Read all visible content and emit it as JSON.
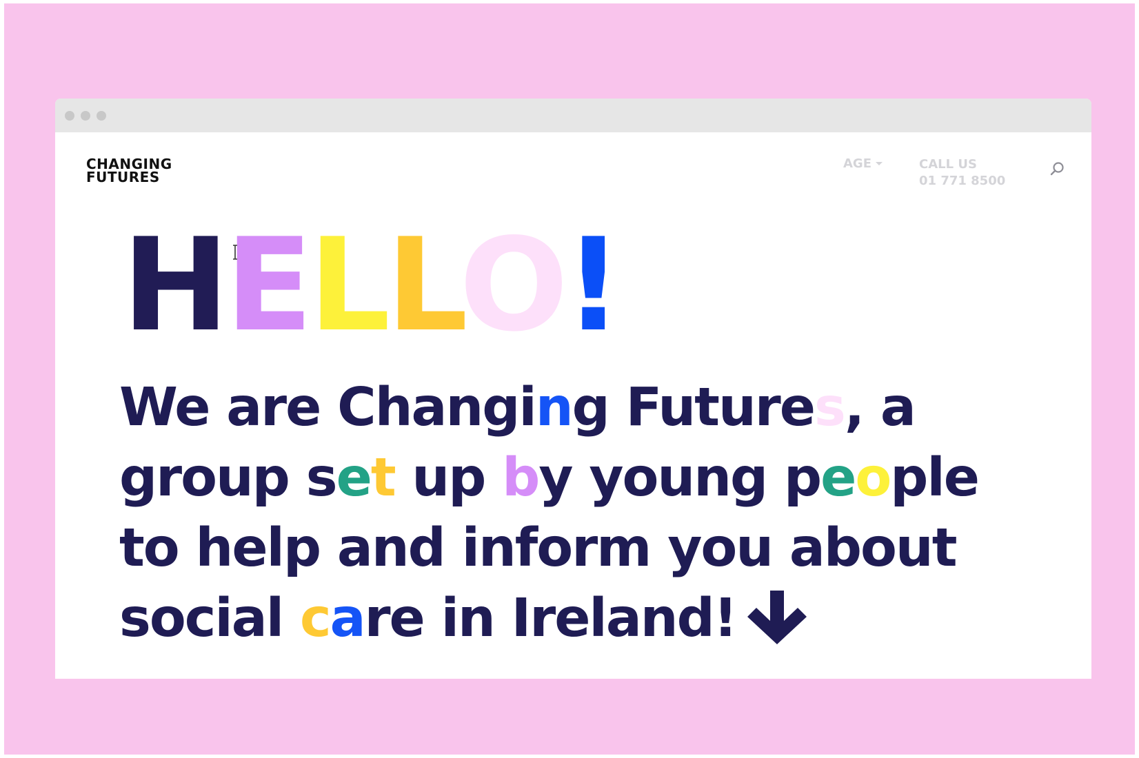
{
  "header": {
    "logo": [
      "CHANGING",
      "FUTURES"
    ],
    "nav": {
      "age_label": "AGE",
      "call_title": "CALL US",
      "call_number": "01 771 8500"
    }
  },
  "hero": {
    "hello": [
      {
        "ch": "H",
        "color": "#211c55"
      },
      {
        "ch": "E",
        "color": "#d58df8"
      },
      {
        "ch": "L",
        "color": "#fdf13a"
      },
      {
        "ch": "L",
        "color": "#fec934"
      },
      {
        "ch": "O",
        "color": "#fde0fa"
      },
      {
        "ch": "!",
        "color": "#0b4ff7"
      }
    ],
    "intro_lines": [
      [
        {
          "t": "We are Changi"
        },
        {
          "t": "n",
          "color": "#1554f6"
        },
        {
          "t": "g Future"
        },
        {
          "t": "s",
          "color": "#fde0fa"
        },
        {
          "t": ", a"
        }
      ],
      [
        {
          "t": "group s"
        },
        {
          "t": "e",
          "color": "#23a286"
        },
        {
          "t": "t",
          "color": "#fec934"
        },
        {
          "t": " up "
        },
        {
          "t": "b",
          "color": "#d58df8"
        },
        {
          "t": "y young p"
        },
        {
          "t": "e",
          "color": "#23a286"
        },
        {
          "t": "o",
          "color": "#fdf13a"
        },
        {
          "t": "ple"
        }
      ],
      [
        {
          "t": "to help and inform you about"
        }
      ],
      [
        {
          "t": "social "
        },
        {
          "t": "c",
          "color": "#fec934"
        },
        {
          "t": "a",
          "color": "#1554f6"
        },
        {
          "t": "re in Ireland!"
        }
      ]
    ]
  },
  "colors": {
    "background": "#f9c4ec",
    "text": "#1f1c54",
    "nav_text": "#d4d4d8"
  },
  "icons": {
    "arrow": "arrow-down-icon",
    "search": "search-icon",
    "cursor": "text-cursor-icon"
  }
}
